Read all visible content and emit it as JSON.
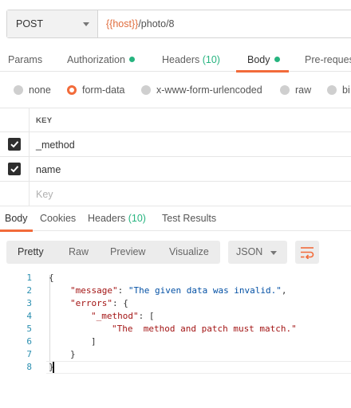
{
  "request": {
    "method": "POST",
    "url_var": "{{host}}",
    "url_path": "/photo/8"
  },
  "request_tabs": [
    {
      "label": "Params"
    },
    {
      "label": "Authorization"
    },
    {
      "label": "Headers",
      "count": "(10)"
    },
    {
      "label": "Body"
    },
    {
      "label": "Pre-reques"
    }
  ],
  "body_types": [
    "none",
    "form-data",
    "x-www-form-urlencoded",
    "raw",
    "bi"
  ],
  "form": {
    "header": "KEY",
    "rows": [
      {
        "key": "_method",
        "checked": true
      },
      {
        "key": "name",
        "checked": true
      }
    ],
    "placeholder": "Key"
  },
  "response_tabs": [
    {
      "label": "Body"
    },
    {
      "label": "Cookies"
    },
    {
      "label": "Headers",
      "count": "(10)"
    },
    {
      "label": "Test Results"
    }
  ],
  "response_view": {
    "modes": [
      "Pretty",
      "Raw",
      "Preview",
      "Visualize"
    ],
    "format": "JSON"
  },
  "code": {
    "line_numbers": [
      "1",
      "2",
      "3",
      "4",
      "5",
      "6",
      "7",
      "8"
    ],
    "l1": "{",
    "l2_key": "\"message\"",
    "l2_colon": ": ",
    "l2_val": "\"The given data was invalid.\"",
    "l2_end": ",",
    "l3_key": "\"errors\"",
    "l3_rest": ": {",
    "l4_key": "\"_method\"",
    "l4_rest": ": [",
    "l5_val": "\"The  method and patch must match.\"",
    "l6": "]",
    "l7": "}",
    "l8": "}"
  },
  "colors": {
    "accent": "#f26b3a",
    "green": "#26b47f",
    "line_number": "#2b8fb0",
    "json_key": "#a31515",
    "json_string": "#0451a5"
  }
}
